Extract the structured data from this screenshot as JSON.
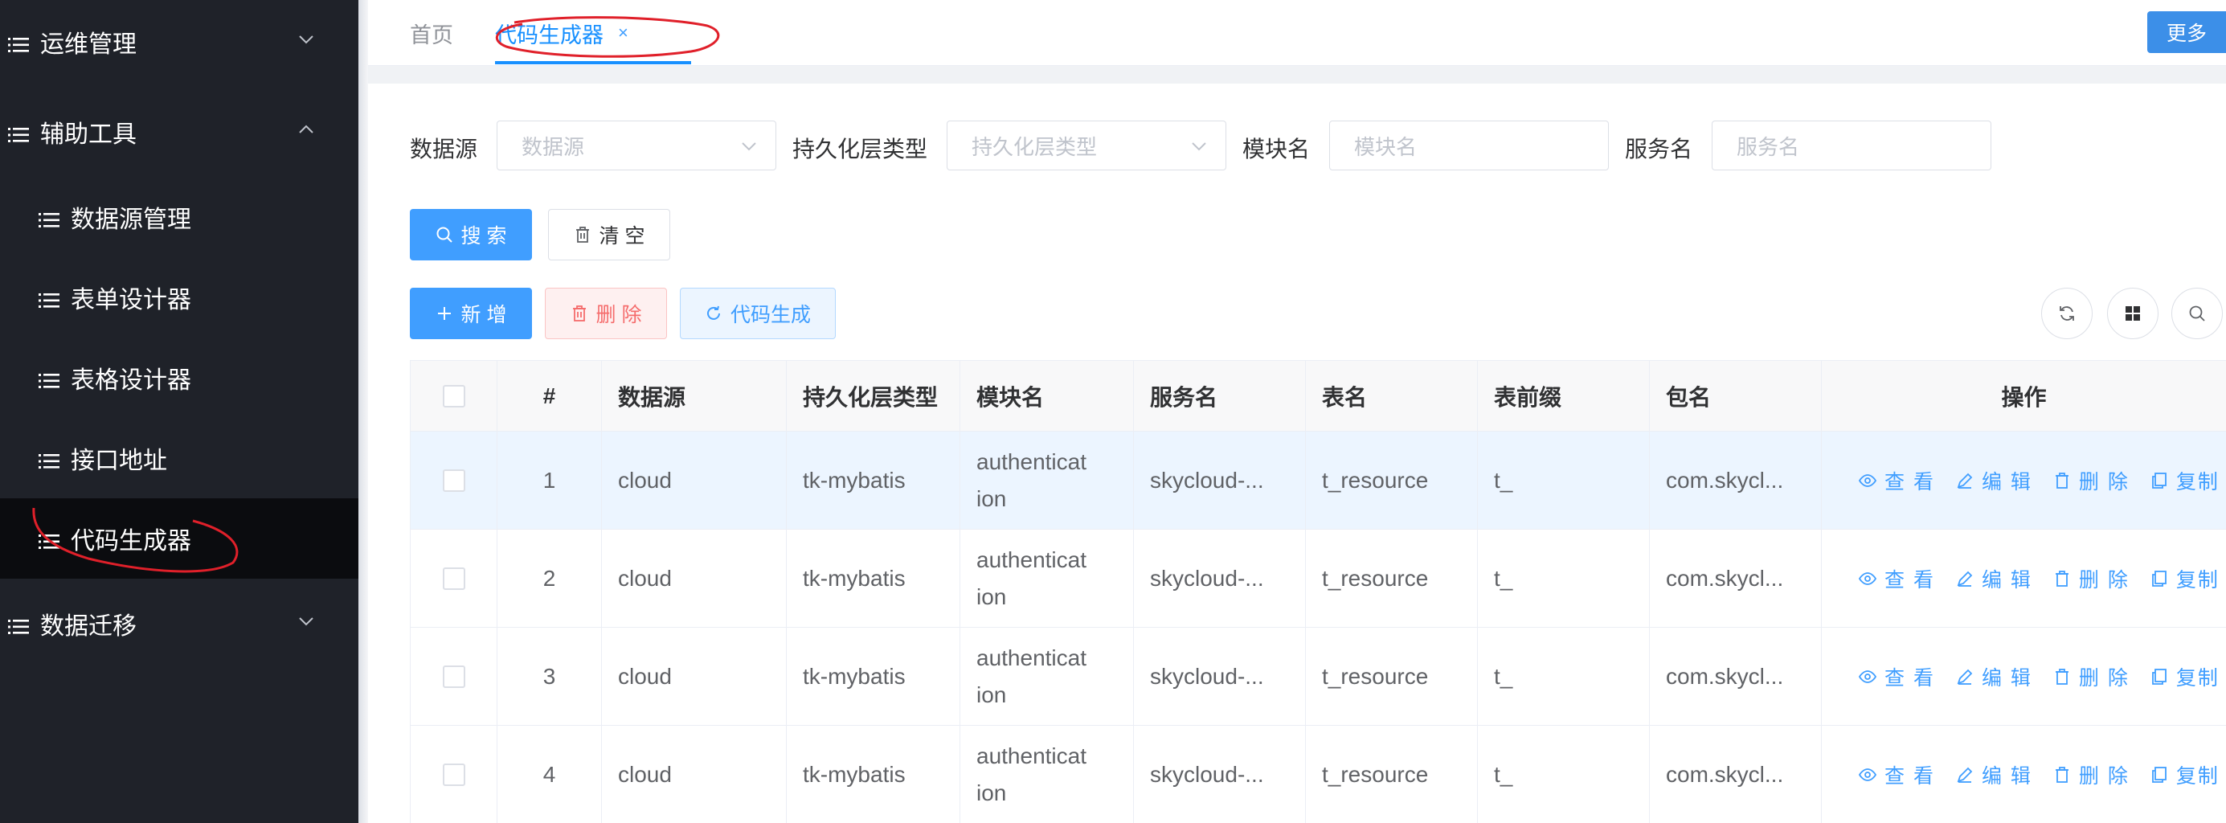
{
  "sidebar": {
    "items": [
      {
        "label": "运维管理",
        "expanded": false
      },
      {
        "label": "辅助工具",
        "expanded": true
      },
      {
        "label": "数据源管理"
      },
      {
        "label": "表单设计器"
      },
      {
        "label": "表格设计器"
      },
      {
        "label": "接口地址"
      },
      {
        "label": "代码生成器",
        "active": true
      },
      {
        "label": "数据迁移",
        "expanded": false
      }
    ]
  },
  "tabs": {
    "home": "首页",
    "active": "代码生成器",
    "close": "×",
    "more": "更多"
  },
  "search": {
    "datasource_label": "数据源",
    "datasource_placeholder": "数据源",
    "persist_label": "持久化层类型",
    "persist_placeholder": "持久化层类型",
    "module_label": "模块名",
    "module_placeholder": "模块名",
    "service_label": "服务名",
    "service_placeholder": "服务名",
    "search_btn": "搜 索",
    "clear_btn": "清 空"
  },
  "toolbar": {
    "add": "新 增",
    "delete": "删 除",
    "generate": "代码生成"
  },
  "table": {
    "headers": [
      "#",
      "数据源",
      "持久化层类型",
      "模块名",
      "服务名",
      "表名",
      "表前缀",
      "包名",
      "操作"
    ],
    "rows": [
      {
        "index": "1",
        "datasource": "cloud",
        "persist": "tk-mybatis",
        "module": "authentication",
        "service": "skycloud-...",
        "table": "t_resource",
        "prefix": "t_",
        "package": "com.skycl..."
      },
      {
        "index": "2",
        "datasource": "cloud",
        "persist": "tk-mybatis",
        "module": "authentication",
        "service": "skycloud-...",
        "table": "t_resource",
        "prefix": "t_",
        "package": "com.skycl..."
      },
      {
        "index": "3",
        "datasource": "cloud",
        "persist": "tk-mybatis",
        "module": "authentication",
        "service": "skycloud-...",
        "table": "t_resource",
        "prefix": "t_",
        "package": "com.skycl..."
      },
      {
        "index": "4",
        "datasource": "cloud",
        "persist": "tk-mybatis",
        "module": "authentication",
        "service": "skycloud-...",
        "table": "t_resource",
        "prefix": "t_",
        "package": "com.skycl..."
      }
    ],
    "ops": {
      "view": "查 看",
      "edit": "编 辑",
      "delete": "删 除",
      "copy": "复制"
    }
  },
  "colors": {
    "sidebar_bg": "#1f2229",
    "primary": "#409eff",
    "danger": "#f56c6c",
    "annotation": "#e0202a"
  }
}
